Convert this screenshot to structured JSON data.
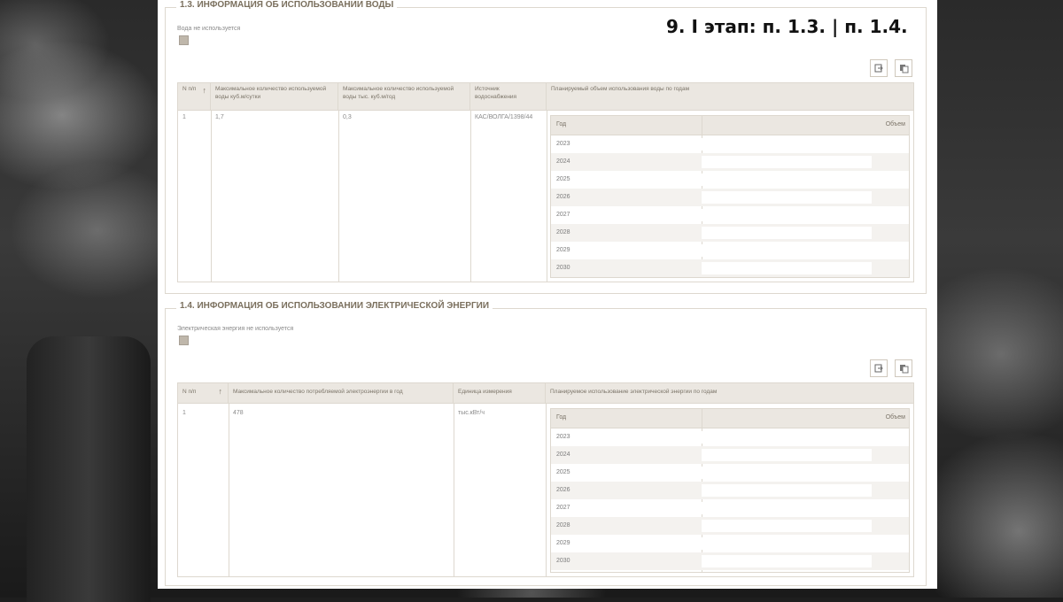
{
  "slide_title": "9. I этап: п. 1.3. | п. 1.4.",
  "water": {
    "title": "1.3. ИНФОРМАЦИЯ ОБ ИСПОЛЬЗОВАНИИ ВОДЫ",
    "checkbox_label": "Вода не используется",
    "headers": {
      "num": "N п/п",
      "sort_arrow": "↑",
      "max_day": "Максимальное количество используемой воды куб.м/сутки",
      "max_year": "Максимальное количество используемой воды тыс. куб.м/год",
      "source": "Источник водоснабжения",
      "planned": "Планируемый объем использования воды по годам"
    },
    "row": {
      "num": "1",
      "max_day": "1,7",
      "max_year": "0,3",
      "source": "КАС/ВОЛГА/1398/44"
    },
    "sub_headers": {
      "year": "Год",
      "volume": "Объем"
    },
    "years": [
      "2023",
      "2024",
      "2025",
      "2026",
      "2027",
      "2028",
      "2029",
      "2030"
    ]
  },
  "electricity": {
    "title": "1.4. ИНФОРМАЦИЯ ОБ ИСПОЛЬЗОВАНИИ ЭЛЕКТРИЧЕСКОЙ ЭНЕРГИИ",
    "checkbox_label": "Электрическая энергия не используется",
    "headers": {
      "num": "N п/п",
      "sort_arrow": "↑",
      "max": "Максимальное количество потребляемой электроэнергии в год",
      "unit": "Единица измерения",
      "planned": "Планируемое использование электрической энергии по годам"
    },
    "row": {
      "num": "1",
      "max": "478",
      "unit": "тыс.кВт/ч"
    },
    "sub_headers": {
      "year": "Год",
      "volume": "Объем"
    },
    "years": [
      "2023",
      "2024",
      "2025",
      "2026",
      "2027",
      "2028",
      "2029",
      "2030"
    ]
  },
  "icons": {
    "export": "export-icon",
    "copy": "copy-icon"
  }
}
